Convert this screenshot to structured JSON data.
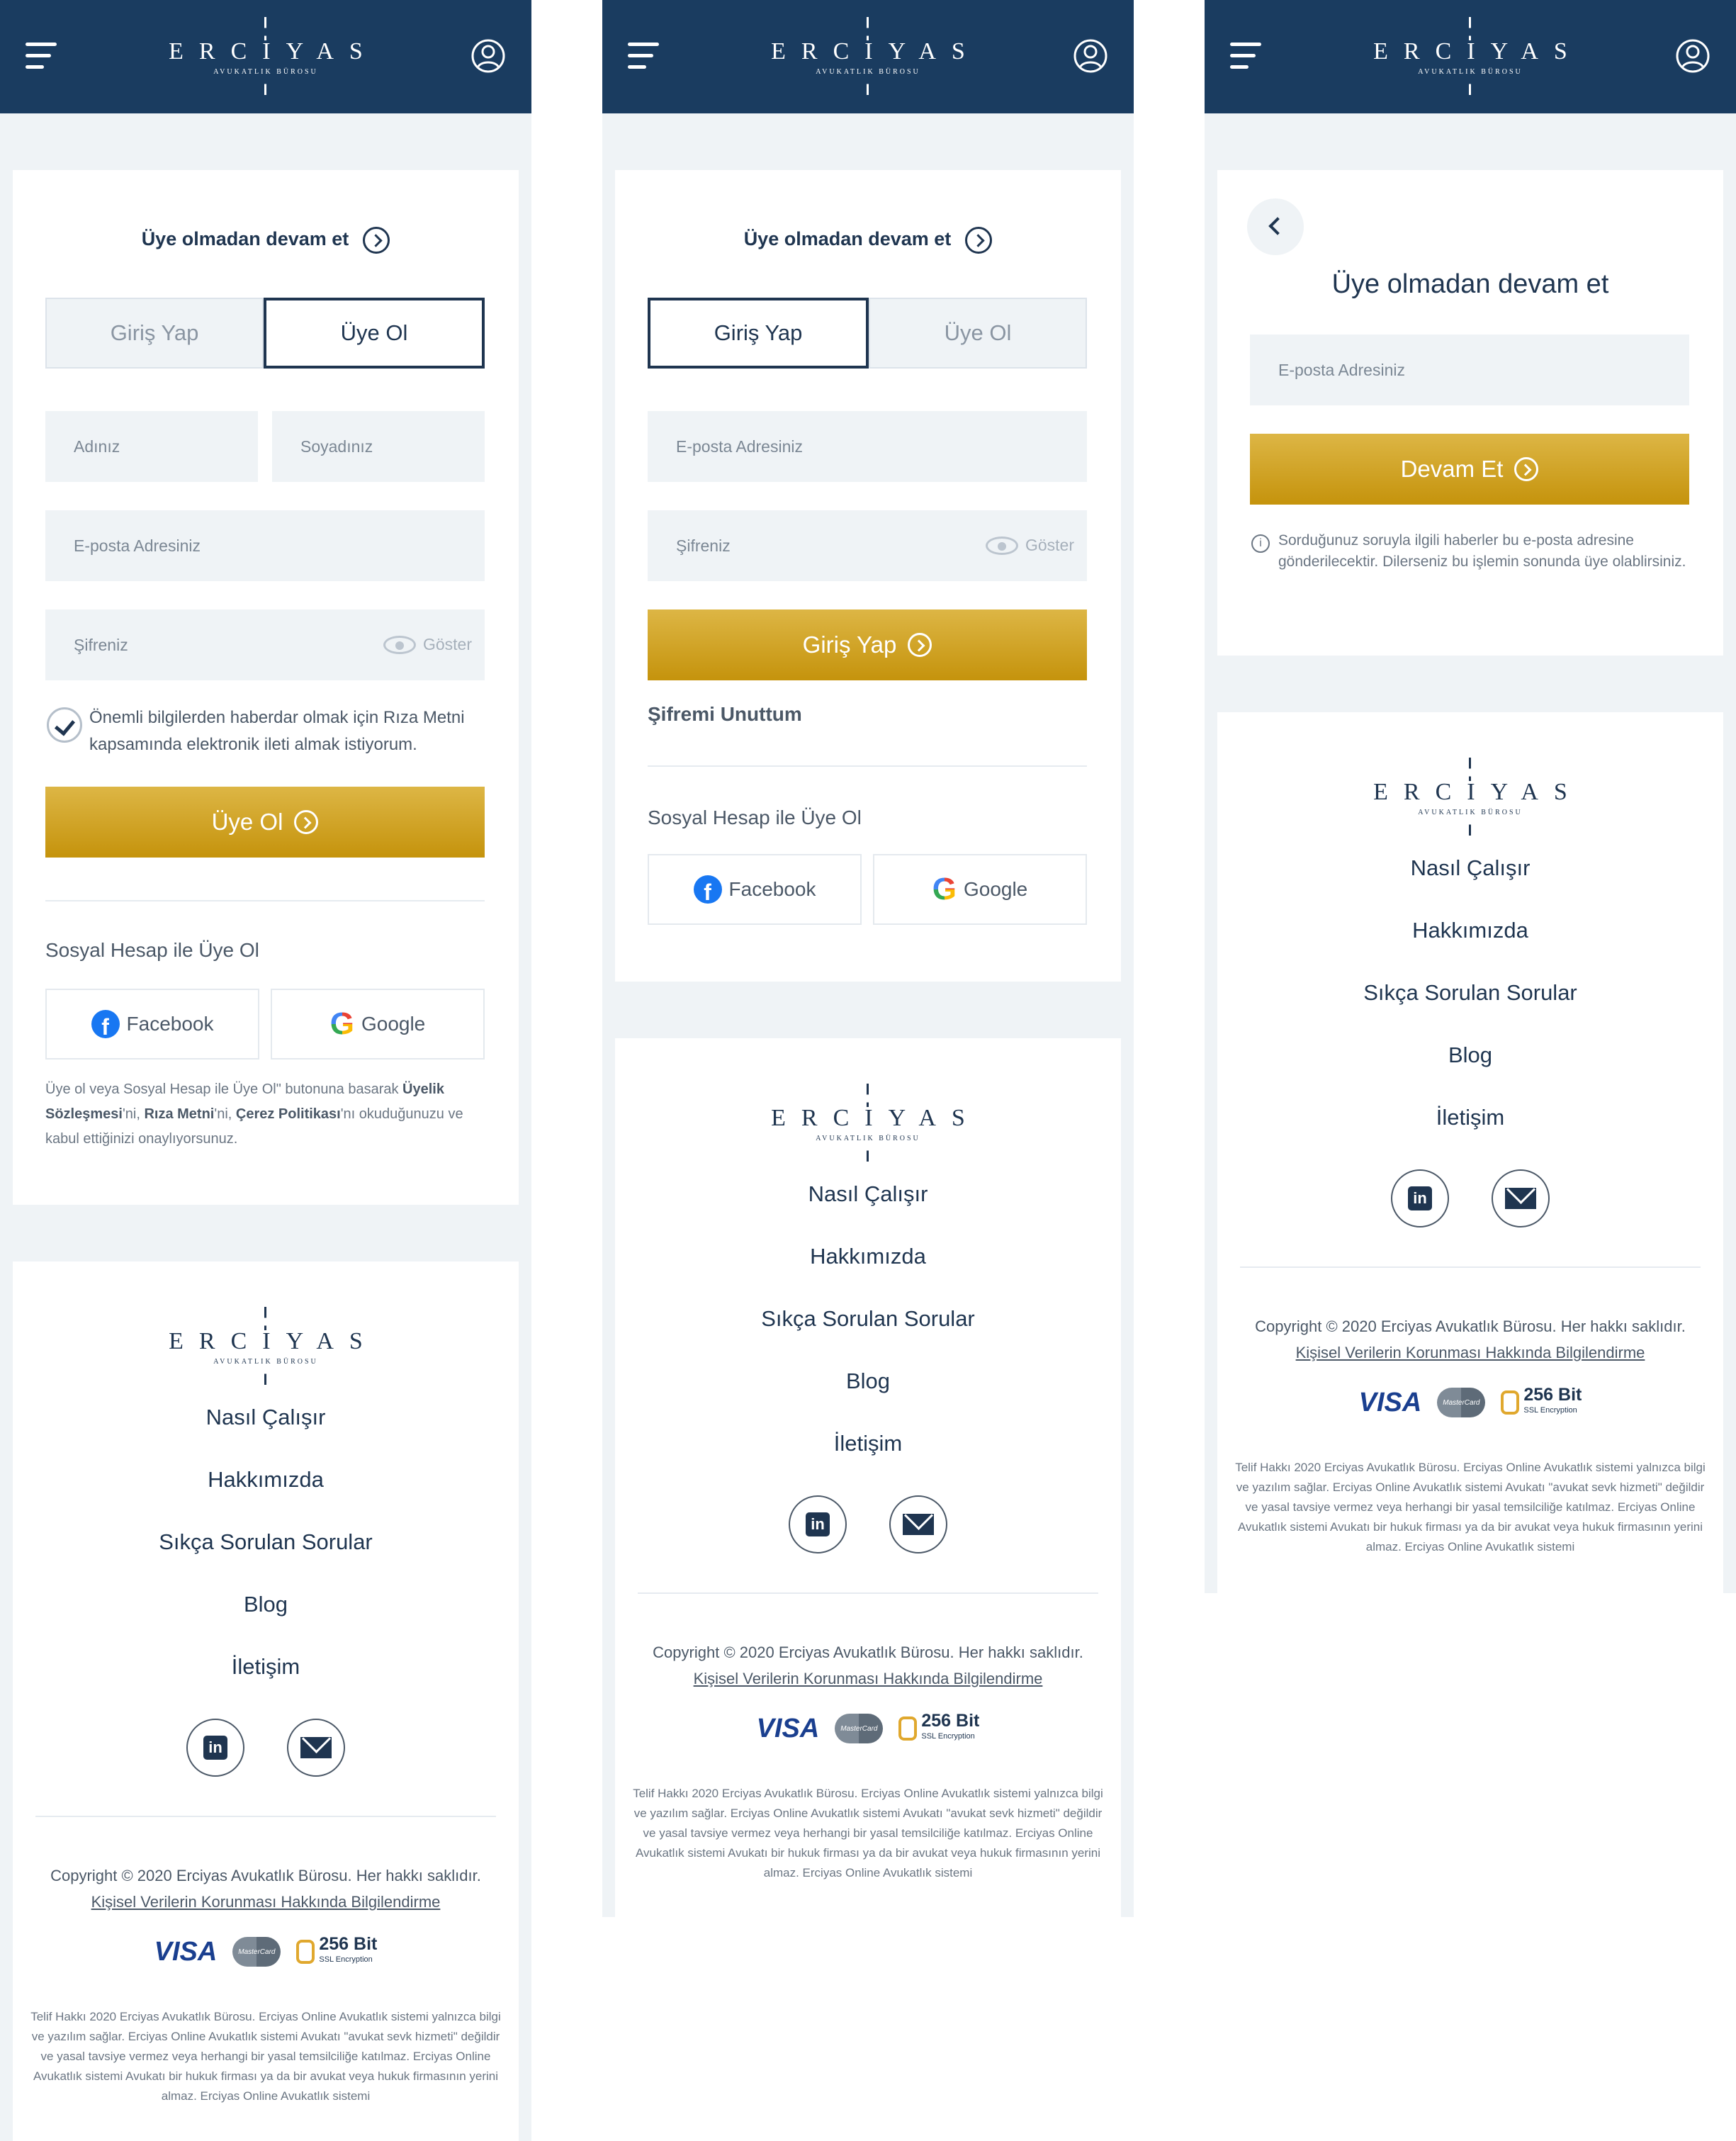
{
  "brand": {
    "name": "ERCIYAS",
    "subtitle": "AVUKATLIK BÜROSU"
  },
  "colors": {
    "navy": "#1a3c60",
    "gold": "#c5930c",
    "bg": "#eff3f6"
  },
  "icons": [
    "menu-icon",
    "user-icon",
    "arrow-right-circle-icon",
    "eye-icon",
    "check-icon",
    "facebook-icon",
    "google-icon",
    "chevron-left-icon",
    "info-icon",
    "linkedin-icon",
    "mail-icon",
    "lock-icon"
  ],
  "continue_link": "Üye olmadan devam et",
  "tabs": {
    "login": "Giriş Yap",
    "register": "Üye Ol"
  },
  "fields": {
    "first_name": "Adınız",
    "last_name": "Soyadınız",
    "email": "E-posta Adresiniz",
    "password": "Şifreniz",
    "show": "Göster"
  },
  "consent": "Önemli bilgilerden haberdar olmak için Rıza Metni kapsamında elektronik ileti almak istiyorum.",
  "buttons": {
    "register": "Üye Ol",
    "login": "Giriş Yap",
    "continue": "Devam Et"
  },
  "forgot": "Şifremi Unuttum",
  "social": {
    "heading": "Sosyal Hesap ile Üye Ol",
    "facebook": "Facebook",
    "google": "Google"
  },
  "terms": {
    "prefix": "Üye ol veya Sosyal Hesap ile Üye Ol\" butonuna basarak",
    "membership": "Üyelik Sözleşmesi",
    "sep1": "'ni,",
    "consent_text": "Rıza Metni",
    "sep2": "'ni,",
    "cookie": "Çerez Politikası",
    "suffix": "'nı okuduğunuzu ve kabul ettiğinizi onaylıyorsunuz."
  },
  "guest": {
    "title": "Üye olmadan devam et",
    "info": "Sorduğunuz soruyla ilgili haberler bu e-posta adresine gönderilecektir. Dilerseniz bu işlemin sonunda üye olablirsiniz."
  },
  "footer": {
    "nav": [
      "Nasıl Çalışır",
      "Hakkımızda",
      "Sıkça Sorulan Sorular",
      "Blog",
      "İletişim"
    ],
    "copyright": "Copyright © 2020 Erciyas Avukatlık Bürosu. Her hakkı saklıdır.",
    "privacy": "Kişisel Verilerin Korunması Hakkında Bilgilendirme",
    "visa": "VISA",
    "mastercard": "MasterCard",
    "ssl_bit": "256 Bit",
    "ssl_label": "SSL Encryption",
    "legal": "Telif Hakkı 2020 Erciyas Avukatlık Bürosu. Erciyas Online Avukatlık sistemi yalnızca bilgi ve yazılım sağlar. Erciyas Online Avukatlık sistemi Avukatı \"avukat sevk hizmeti\" değildir ve yasal tavsiye vermez veya herhangi bir yasal temsilciliğe katılmaz. Erciyas Online Avukatlık sistemi Avukatı bir hukuk firması ya da bir avukat veya hukuk firmasının yerini almaz. Erciyas Online Avukatlık sistemi"
  }
}
